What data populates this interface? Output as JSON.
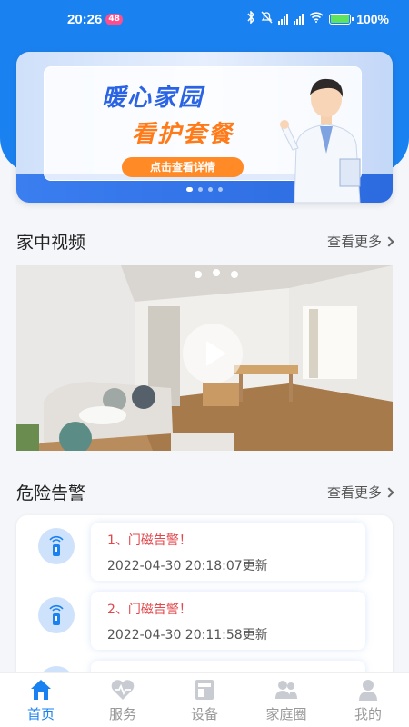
{
  "status": {
    "time": "20:26",
    "badge": "48",
    "battery": "100%"
  },
  "banner": {
    "title1": "暖心家园",
    "title2": "看护套餐",
    "button": "点击查看详情"
  },
  "video_section": {
    "title": "家中视频",
    "more": "查看更多"
  },
  "alert_section": {
    "title": "危险告警",
    "more": "查看更多"
  },
  "alerts": [
    {
      "title": "1、门磁告警！",
      "time": "2022-04-30 20:18:07更新"
    },
    {
      "title": "2、门磁告警！",
      "time": "2022-04-30 20:11:58更新"
    },
    {
      "title": "",
      "time": ""
    }
  ],
  "tabs": [
    {
      "label": "首页",
      "icon": "home-icon",
      "active": true
    },
    {
      "label": "服务",
      "icon": "heart-pulse-icon"
    },
    {
      "label": "设备",
      "icon": "device-icon"
    },
    {
      "label": "家庭圈",
      "icon": "family-icon"
    },
    {
      "label": "我的",
      "icon": "person-icon"
    }
  ],
  "colors": {
    "primary": "#1a82f0",
    "alert": "#e2474b",
    "accent": "#ff8a26"
  }
}
